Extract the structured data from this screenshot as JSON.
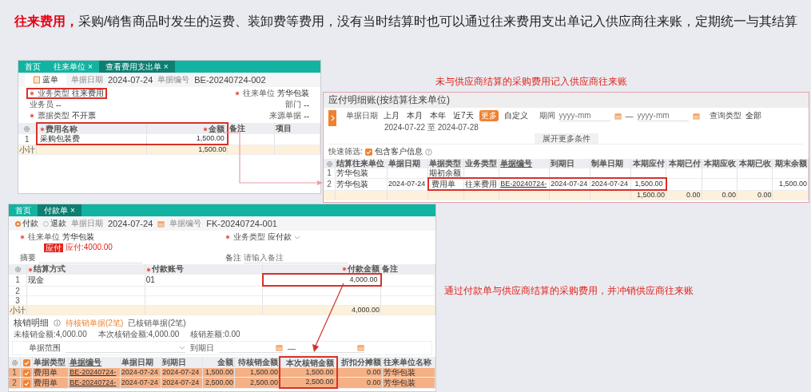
{
  "heading": {
    "highlight": "往来费用，",
    "text": "采购/销售商品时发生的运费、装卸费等费用，没有当时结算时也可以通过往来费用支出单记入供应商往来账，定期统一与其结算"
  },
  "expense_doc": {
    "tabs": [
      {
        "label": "首页",
        "selected": false
      },
      {
        "label": "往来单位",
        "close": "×",
        "selected": false
      },
      {
        "label": "查看费用支出单",
        "close": "×",
        "selected": true
      }
    ],
    "doc_type": "蓝单",
    "meta": [
      {
        "label": "单据日期",
        "value": "2024-07-24"
      },
      {
        "label": "单据编号",
        "value": "BE-20240724-002"
      }
    ],
    "fields": [
      {
        "left": {
          "label": "业务类型",
          "value": "往来费用",
          "required": true,
          "highlighted": true
        },
        "right": {
          "label": "往来单位",
          "value": "芳华包装",
          "required": true,
          "highlighted": false
        }
      },
      {
        "left": {
          "label": "业务员",
          "value": "--",
          "required": false,
          "highlighted": false
        },
        "right": {
          "label": "部门",
          "value": "--",
          "required": false,
          "highlighted": false
        }
      },
      {
        "left": {
          "label": "票据类型",
          "value": "不开票",
          "required": true,
          "highlighted": false
        },
        "right": {
          "label": "来源单据",
          "value": "--",
          "required": false,
          "highlighted": false
        }
      }
    ],
    "table": {
      "columns": [
        {
          "label": "费用名称",
          "required": true,
          "kind": "text",
          "highlighted": true
        },
        {
          "label": "金额",
          "required": true,
          "kind": "amount",
          "highlighted": true
        },
        {
          "label": "备注",
          "required": false,
          "kind": "text",
          "highlighted": false
        },
        {
          "label": "项目",
          "required": false,
          "kind": "text",
          "highlighted": false
        }
      ],
      "rows": [
        {
          "index": "1",
          "cells": [
            {
              "text": "采购包装费",
              "highlighted": true
            },
            {
              "text": "1,500.00",
              "highlighted": true
            }
          ]
        }
      ],
      "footer": {
        "label": "小计",
        "cells": [
          null,
          "1,500.00"
        ]
      }
    }
  },
  "ledger_caption": "未与供应商结算的采购费用记入供应商往来账",
  "ledger": {
    "title": "应付明细账(按结算往来单位)",
    "date_label": "单据日期",
    "periods": [
      {
        "label": "上月",
        "selected": false
      },
      {
        "label": "本月",
        "selected": false
      },
      {
        "label": "本年",
        "selected": false
      },
      {
        "label": "近7天",
        "selected": false
      },
      {
        "label": "更多",
        "selected": true
      },
      {
        "label": "自定义",
        "selected": false
      }
    ],
    "date_range": "2024-07-22 至 2024-07-28",
    "period_label": "期间",
    "period_placeholder": "yyyy-mm",
    "period_separator": "—",
    "period_end_placeholder": "yyyy-mm",
    "query_label": "查询类型",
    "query_value": "全部",
    "expand": "展开更多条件",
    "quick_label": "快速筛选:",
    "quick_option": {
      "label": "包含客户信息",
      "checked": true
    },
    "table": {
      "columns": [
        {
          "label": "结算往来单位",
          "kind": "text",
          "highlighted": false
        },
        {
          "label": "单据日期",
          "kind": "date",
          "highlighted": false
        },
        {
          "label": "单据类型",
          "kind": "text",
          "highlighted": false
        },
        {
          "label": "业务类型",
          "kind": "text",
          "highlighted": false
        },
        {
          "label": "单据编号",
          "kind": "code",
          "highlighted": false
        },
        {
          "label": "到期日",
          "kind": "date",
          "highlighted": false
        },
        {
          "label": "制单日期",
          "kind": "date",
          "highlighted": false
        },
        {
          "label": "本期应付",
          "kind": "amount",
          "highlighted": false
        },
        {
          "label": "本期已付",
          "kind": "amount",
          "highlighted": false
        },
        {
          "label": "本期应收",
          "kind": "amount",
          "highlighted": false
        },
        {
          "label": "本期已收",
          "kind": "amount",
          "highlighted": false
        },
        {
          "label": "期末余额",
          "kind": "amount",
          "highlighted": false
        }
      ],
      "rows": [
        {
          "index": "1",
          "cells": [
            "芳华包装",
            null,
            "期初余额"
          ]
        },
        {
          "index": "2",
          "cells": [
            "芳华包装",
            "2024-07-24",
            {
              "text": "费用单",
              "highlighted": true
            },
            {
              "text": "往来费用",
              "highlighted": true
            },
            {
              "text": "BE-20240724-",
              "highlighted": true
            },
            {
              "text": "2024-07-24",
              "highlighted": true
            },
            {
              "text": "2024-07-24",
              "highlighted": true
            },
            {
              "text": "1,500.00",
              "highlighted": true
            },
            null,
            null,
            null,
            "1,500.00"
          ]
        }
      ],
      "footer": {
        "cells": [
          null,
          null,
          null,
          null,
          null,
          null,
          null,
          "1,500.00",
          "0.00",
          "0.00",
          "0.00"
        ]
      }
    }
  },
  "payment_caption": "通过付款单与供应商结算的采购费用，并冲销供应商往来账",
  "payment_doc": {
    "tabs": [
      {
        "label": "首页",
        "selected": false
      },
      {
        "label": "付款单",
        "close": "×",
        "selected": true
      }
    ],
    "directions": [
      {
        "label": "付款",
        "selected": true
      },
      {
        "label": "退款",
        "selected": false
      }
    ],
    "meta": [
      {
        "label": "单据日期",
        "value": "2024-07-24",
        "calendar": true
      },
      {
        "label": "单据编号",
        "value": "FK-20240724-001"
      }
    ],
    "fields": [
      {
        "left": {
          "label": "往来单位",
          "value": "芳华包装",
          "required": true,
          "highlighted": false,
          "note": {
            "badge": "应付",
            "text": "应付:4000.00"
          }
        },
        "right": {
          "label": "业务类型",
          "value": "应付款",
          "required": true,
          "highlighted": false,
          "dropdown": true
        }
      },
      {
        "left": {
          "label": "摘要",
          "required": false,
          "highlighted": false
        },
        "right": {
          "label": "备注",
          "placeholder": "请输入备注",
          "required": false,
          "highlighted": false
        }
      }
    ],
    "table": {
      "columns": [
        {
          "label": "结算方式",
          "required": true,
          "kind": "text",
          "highlighted": false
        },
        {
          "label": "付款账号",
          "required": true,
          "kind": "text",
          "highlighted": false
        },
        {
          "label": "付款金额",
          "required": true,
          "kind": "amount",
          "highlighted": false
        },
        {
          "label": "备注",
          "required": false,
          "kind": "text",
          "highlighted": false
        }
      ],
      "rows": [
        {
          "index": "1",
          "cells": [
            "现金",
            "01",
            {
              "text": "4,000.00",
              "highlighted": true
            }
          ]
        },
        {
          "index": "2",
          "cells": []
        },
        {
          "index": "3",
          "cells": []
        }
      ],
      "footer": {
        "label": "小计",
        "cells": [
          null,
          null,
          "4,000.00"
        ]
      }
    },
    "writeoff": {
      "title": "核销明细",
      "tabs": [
        {
          "label": "待核销单据(2笔)",
          "selected": true
        },
        {
          "label": "已核销单据(2笔)",
          "selected": false
        }
      ],
      "summary": [
        "未核销金额:4,000.00",
        "本次核销金额:4,000.00",
        "核销差额:0.00"
      ],
      "range_label": "单据范围",
      "due_label": "到期日",
      "due_separator": "—",
      "table": {
        "check_column": true,
        "header_checked": true,
        "columns": [
          {
            "label": "单据类型",
            "kind": "text",
            "highlighted": false
          },
          {
            "label": "单据编号",
            "kind": "code",
            "highlighted": false
          },
          {
            "label": "单据日期",
            "kind": "date",
            "highlighted": false
          },
          {
            "label": "到期日",
            "kind": "date",
            "highlighted": false
          },
          {
            "label": "金额",
            "kind": "amount",
            "highlighted": false
          },
          {
            "label": "待核销金额",
            "kind": "amount",
            "highlighted": false
          },
          {
            "label": "本次核销金额",
            "kind": "amount",
            "highlighted": true
          },
          {
            "label": "折扣分摊额",
            "kind": "amount",
            "highlighted": false
          },
          {
            "label": "往来单位名称",
            "kind": "text",
            "highlighted": false
          }
        ],
        "rows": [
          {
            "index": "1",
            "selected": true,
            "checked": true,
            "cells": [
              "费用单",
              "BE-20240724-",
              "2024-07-24",
              "2024-07-24",
              "1,500.00",
              "1,500.00",
              {
                "text": "1,500.00",
                "highlighted": true
              },
              "0.00",
              "芳华包装"
            ]
          },
          {
            "index": "2",
            "selected": true,
            "checked": true,
            "cells": [
              "费用单",
              "BE-20240724-",
              "2024-07-24",
              "2024-07-24",
              "2,500.00",
              "2,500.00",
              {
                "text": "2,500.00",
                "highlighted": true
              },
              "0.00",
              "芳华包装"
            ]
          }
        ]
      }
    }
  }
}
